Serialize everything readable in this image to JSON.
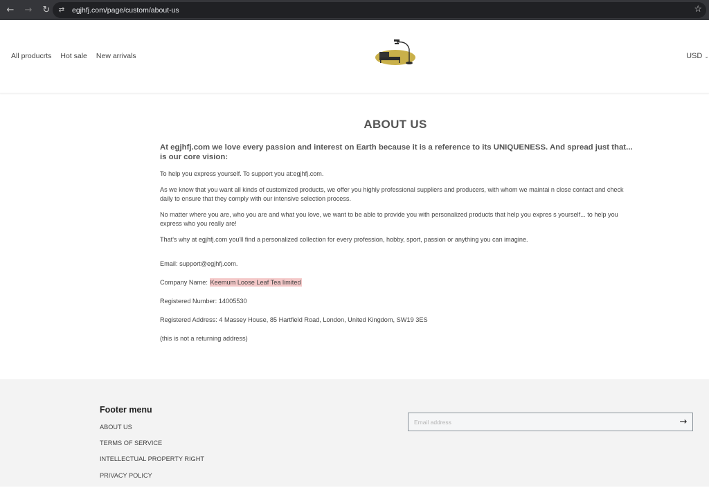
{
  "browser": {
    "url": "egjhfj.com/page/custom/about-us",
    "back_icon": "←",
    "forward_icon": "→",
    "reload_icon": "↻",
    "site_info_icon": "⇄",
    "bookmark_icon": "☆"
  },
  "header": {
    "nav": [
      {
        "label": "All producrts"
      },
      {
        "label": "Hot sale"
      },
      {
        "label": "New arrivals"
      }
    ],
    "logo_alt": "sofa-and-lamp-logo",
    "currency": "USD",
    "currency_chevron": "⌄",
    "colors": {
      "logo_ellipse": "#c9b04a",
      "logo_sofa": "#2b2b2b"
    }
  },
  "main": {
    "title": "ABOUT US",
    "lead": "At egjhfj.com we love every passion and interest on Earth because it is a reference to its UNIQUENESS. And spread just that... is our core vision:",
    "paragraphs": [
      "To help you express yourself. To support you at:egjhfj.com.",
      "As we know that you want all kinds of customized products, we offer you highly professional suppliers and producers, with whom we maintai n close contact and check daily to ensure that they comply with our intensive selection process.",
      "No matter where you are, who you are and what you love, we want to be able to provide you with personalized products that help you expres s yourself... to help you express who you really are!",
      "That's why at egjhfj.com you'll find a personalized collection for every profession, hobby, sport, passion or anything you can imagine."
    ],
    "info": {
      "email": "Email: support@egjhfj.com.",
      "company_label": "Company Name: ",
      "company_value": "Keemum Loose Leaf Tea limited",
      "registered_number": "Registered Number: 14005530",
      "registered_address": "Registered Address: 4 Massey House, 85 Hartfield Road, London, United Kingdom, SW19 3ES",
      "note": "(this is not a returning address)"
    },
    "highlight_color": "#f4c8c8"
  },
  "footer": {
    "heading": "Footer menu",
    "links": [
      {
        "label": "ABOUT US"
      },
      {
        "label": "TERMS OF SERVICE"
      },
      {
        "label": "INTELLECTUAL PROPERTY RIGHT"
      },
      {
        "label": "PRIVACY POLICY"
      }
    ],
    "newsletter": {
      "placeholder": "Email address",
      "value": "",
      "submit_icon": "→"
    }
  }
}
